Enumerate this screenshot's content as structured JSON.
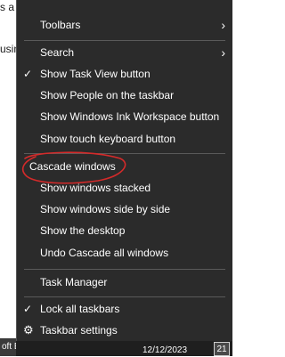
{
  "background": {
    "fragment_top": "s a",
    "fragment_mid": "usin",
    "fragment_bottom_left": "oft E"
  },
  "menu": {
    "items": [
      {
        "label": "Toolbars",
        "submenu": true
      },
      {
        "label": "Search",
        "submenu": true
      },
      {
        "label": "Show Task View button",
        "checked": true
      },
      {
        "label": "Show People on the taskbar"
      },
      {
        "label": "Show Windows Ink Workspace button"
      },
      {
        "label": "Show touch keyboard button"
      },
      {
        "label": "Cascade windows"
      },
      {
        "label": "Show windows stacked"
      },
      {
        "label": "Show windows side by side"
      },
      {
        "label": "Show the desktop"
      },
      {
        "label": "Undo Cascade all windows"
      },
      {
        "label": "Task Manager"
      },
      {
        "label": "Lock all taskbars",
        "checked": true
      },
      {
        "label": "Taskbar settings",
        "icon": "gear-icon"
      }
    ],
    "check_glyph": "✓",
    "gear_glyph": "⚙",
    "arrow_glyph": "›"
  },
  "taskbar": {
    "date": "12/12/2023",
    "notification_count": "21"
  },
  "colors": {
    "menu_bg": "#2b2b2b",
    "menu_text": "#ffffff",
    "separator": "#5a5a5a",
    "annotation": "#d42a2a"
  }
}
